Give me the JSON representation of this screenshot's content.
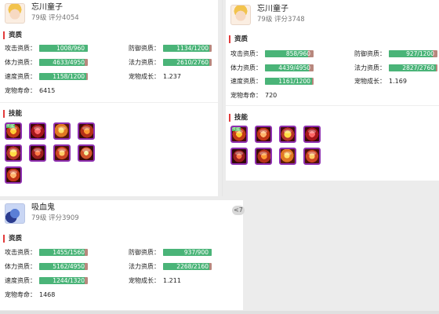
{
  "pets": [
    {
      "name": "忘川童子",
      "level": "79级",
      "score": "评分4054",
      "aptitude_title": "资质",
      "stats": {
        "attack": {
          "label": "攻击资质：",
          "text": "1008/960",
          "ratio": 1.0
        },
        "defense": {
          "label": "防御资质：",
          "text": "1134/1200",
          "ratio": 0.945
        },
        "hp": {
          "label": "体力资质：",
          "text": "4633/4950",
          "ratio": 0.936
        },
        "magic": {
          "label": "法力资质：",
          "text": "2610/2760",
          "ratio": 0.946
        },
        "speed": {
          "label": "速度资质：",
          "text": "1158/1200",
          "ratio": 0.965
        },
        "growth_label": "宠物成长：",
        "growth": "1.237",
        "life_label": "宠物寿命：",
        "life": "6415"
      },
      "skills_title": "技能",
      "skills": [
        "skill-icon",
        "skill-icon",
        "skill-icon",
        "skill-icon",
        "skill-icon",
        "skill-icon",
        "skill-icon",
        "skill-icon",
        "skill-icon"
      ],
      "skill_tag": "技能"
    },
    {
      "name": "忘川童子",
      "level": "79级",
      "score": "评分3748",
      "aptitude_title": "资质",
      "stats": {
        "attack": {
          "label": "攻击资质：",
          "text": "858/960",
          "ratio": 0.894
        },
        "defense": {
          "label": "防御资质：",
          "text": "927/1200",
          "ratio": 0.9
        },
        "hp": {
          "label": "体力资质：",
          "text": "4439/4950",
          "ratio": 0.897
        },
        "magic": {
          "label": "法力资质：",
          "text": "2827/2760",
          "ratio": 0.97
        },
        "speed": {
          "label": "速度资质：",
          "text": "1161/1200",
          "ratio": 0.967
        },
        "growth_label": "宠物成长：",
        "growth": "1.169",
        "life_label": "宠物寿命：",
        "life": "720"
      },
      "skills_title": "技能",
      "skills": [
        "skill-icon",
        "skill-icon",
        "skill-icon",
        "skill-icon",
        "skill-icon",
        "skill-icon",
        "skill-icon",
        "skill-icon"
      ],
      "skill_tag": "技能"
    },
    {
      "name": "吸血鬼",
      "level": "79级",
      "score": "评分3909",
      "aptitude_title": "资质",
      "stats": {
        "attack": {
          "label": "攻击资质：",
          "text": "1455/1560",
          "ratio": 0.933
        },
        "defense": {
          "label": "防御资质：",
          "text": "937/900",
          "ratio": 1.0
        },
        "hp": {
          "label": "体力资质：",
          "text": "5162/4950",
          "ratio": 0.94
        },
        "magic": {
          "label": "法力资质：",
          "text": "2268/2160",
          "ratio": 0.95
        },
        "speed": {
          "label": "速度资质：",
          "text": "1244/1320",
          "ratio": 0.942
        },
        "growth_label": "宠物成长：",
        "growth": "1.211",
        "life_label": "宠物寿命：",
        "life": "1468"
      }
    }
  ],
  "scroll_indicator": "<7",
  "colors": {
    "bar_fill": "#4ab478",
    "bar_bg": "#b8877d",
    "accent": "#e23c3c",
    "skill_border": "#8e2fb0"
  }
}
